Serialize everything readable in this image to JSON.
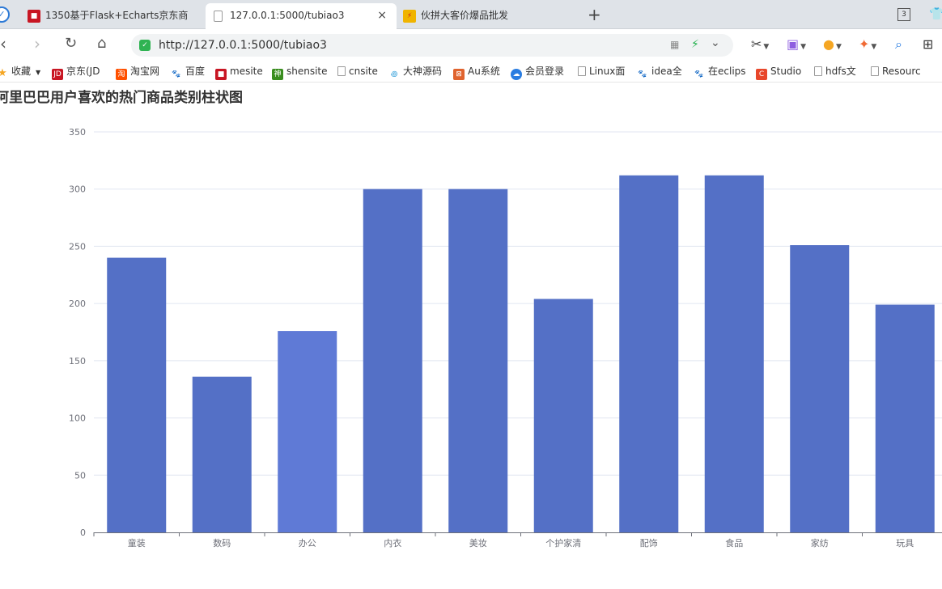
{
  "browser": {
    "tabs": [
      {
        "title": "1350基于Flask+Echarts京东商"
      },
      {
        "title": "127.0.0.1:5000/tubiao3",
        "close": "×"
      },
      {
        "title": "伙拼大客价爆品批发"
      }
    ],
    "new_tab": "+",
    "tab_count": "3",
    "url": "http://127.0.0.1:5000/tubiao3"
  },
  "bookmarks": [
    {
      "label": "收藏",
      "icon": "star-icon",
      "color": "#f5a623"
    },
    {
      "label": "京东(JD",
      "icon": "jd-icon",
      "color": "#c81623"
    },
    {
      "label": "淘宝网",
      "icon": "taobao-icon",
      "color": "#ff5000"
    },
    {
      "label": "百度",
      "icon": "baidu-icon",
      "color": "#2932e1"
    },
    {
      "label": "mesite",
      "icon": "mesite-icon",
      "color": "#c81623"
    },
    {
      "label": "shensite",
      "icon": "shensite-icon",
      "color": "#3a8d1f"
    },
    {
      "label": "cnsite",
      "icon": "doc-icon",
      "color": "#999999"
    },
    {
      "label": "大神源码",
      "icon": "swirl-icon",
      "color": "#2a9bd8"
    },
    {
      "label": "Au系统",
      "icon": "au-icon",
      "color": "#e0632e"
    },
    {
      "label": "会员登录",
      "icon": "cloud-icon",
      "color": "#2a7de1"
    },
    {
      "label": "Linux面",
      "icon": "doc-icon",
      "color": "#999999"
    },
    {
      "label": "idea全",
      "icon": "baidu-icon",
      "color": "#2932e1"
    },
    {
      "label": "在eclips",
      "icon": "baidu-icon",
      "color": "#2932e1"
    },
    {
      "label": "Studio",
      "icon": "c-icon",
      "color": "#e8472b"
    },
    {
      "label": "hdfs文",
      "icon": "doc-icon",
      "color": "#999999"
    },
    {
      "label": "Resourc",
      "icon": "doc-icon",
      "color": "#999999"
    }
  ],
  "chart_data": {
    "type": "bar",
    "title": "阿里巴巴用户喜欢的热门商品类别柱状图",
    "categories": [
      "童装",
      "数码",
      "办公",
      "内衣",
      "美妆",
      "个护家清",
      "配饰",
      "食品",
      "家纺",
      "玩具"
    ],
    "values": [
      240,
      136,
      176,
      300,
      300,
      204,
      312,
      312,
      251,
      199
    ],
    "ylim": [
      0,
      350
    ],
    "yticks": [
      0,
      50,
      100,
      150,
      200,
      250,
      300,
      350
    ],
    "grid": true,
    "bar_color": "#5470c6",
    "highlight_color": "#5f7ad6",
    "highlight_index": 2
  }
}
